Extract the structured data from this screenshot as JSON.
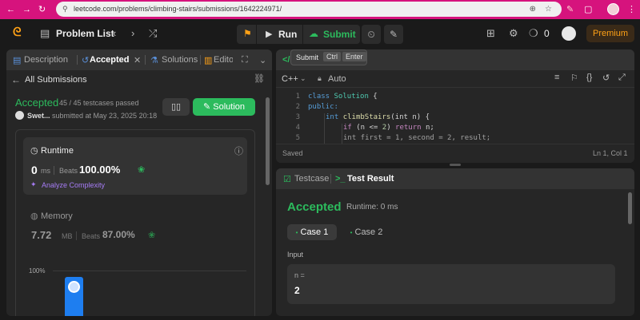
{
  "browser": {
    "url": "leetcode.com/problems/climbing-stairs/submissions/1642224971/"
  },
  "nav": {
    "problem_list": "Problem List",
    "run": "Run",
    "submit": "Submit",
    "streak": "0",
    "premium": "Premium"
  },
  "left_panel": {
    "tabs": {
      "description": "Description",
      "accepted": "Accepted",
      "solutions": "Solutions",
      "editorial": "Edito"
    },
    "all_submissions": "All Submissions",
    "status": "Accepted",
    "testcases": "45 / 45 testcases passed",
    "user": "Swet...",
    "submitted_at": "submitted at May 23, 2025 20:18",
    "solution_btn": "Solution",
    "runtime": {
      "label": "Runtime",
      "value": "0",
      "unit": "ms",
      "beats_label": "Beats",
      "beats_value": "100.00%",
      "analyze": "Analyze Complexity"
    },
    "memory": {
      "label": "Memory",
      "value": "7.72",
      "unit": "MB",
      "beats_label": "Beats",
      "beats_value": "87.00%"
    },
    "chart": {
      "tick_label": "100%"
    }
  },
  "editor": {
    "tooltip": {
      "submit": "Submit",
      "ctrl": "Ctrl",
      "enter": "Enter"
    },
    "language": "C++",
    "auto": "Auto",
    "line_numbers": [
      "1",
      "2",
      "3",
      "4",
      "5"
    ],
    "code": {
      "l1_kw": "class",
      "l1_name": "Solution",
      "l1_brace": " {",
      "l2": "public:",
      "l3_type": "int",
      "l3_fn": "climbStairs",
      "l3_rest": "(int n) {",
      "l4_kw": "if",
      "l4_cond": " (n <= ",
      "l4_num": "2",
      "l4_close": ") ",
      "l4_ret": "return",
      "l4_end": " n;",
      "l5": "int first = 1, second = 2, result;"
    },
    "saved": "Saved",
    "cursor": "Ln 1, Col 1"
  },
  "result_panel": {
    "tabs": {
      "testcase": "Testcase",
      "test_result": "Test Result"
    },
    "status": "Accepted",
    "runtime": "Runtime: 0 ms",
    "cases": [
      "Case 1",
      "Case 2"
    ],
    "input_label": "Input",
    "var_name": "n =",
    "var_value": "2"
  }
}
